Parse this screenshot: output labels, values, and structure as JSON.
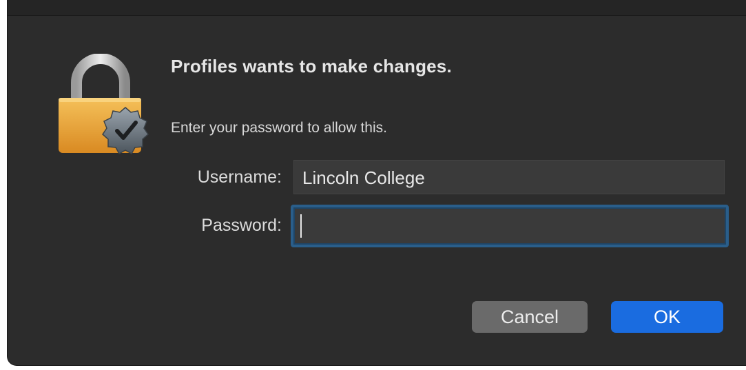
{
  "dialog": {
    "title": "Profiles wants to make changes.",
    "subtitle": "Enter your password to allow this.",
    "icon": "padlock-with-badge-icon"
  },
  "form": {
    "username_label": "Username:",
    "username_value": "Lincoln College",
    "password_label": "Password:",
    "password_value": ""
  },
  "buttons": {
    "cancel_label": "Cancel",
    "ok_label": "OK"
  },
  "colors": {
    "background": "#2c2c2c",
    "accent": "#1a6ce0",
    "focus_ring": "#2a5e8a",
    "lock_gold": "#e6a23a"
  }
}
